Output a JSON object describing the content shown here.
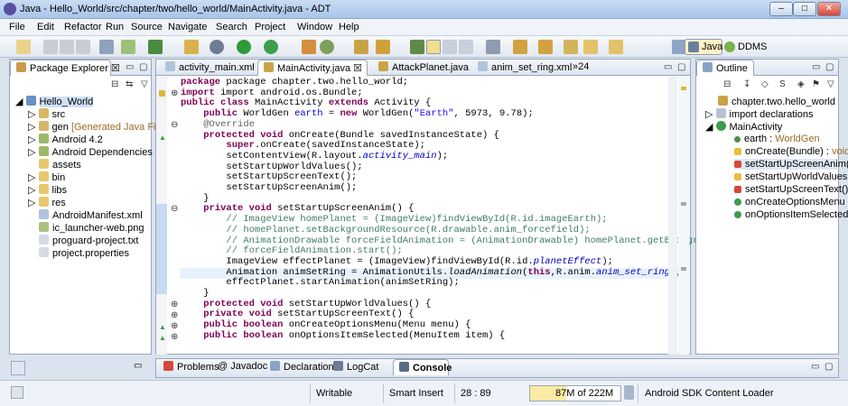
{
  "window": {
    "title": "Java - Hello_World/src/chapter/two/hello_world/MainActivity.java - ADT"
  },
  "menu": [
    "File",
    "Edit",
    "Refactor",
    "Run",
    "Source",
    "Navigate",
    "Search",
    "Project",
    "Window",
    "Help"
  ],
  "perspectives": {
    "java": "Java",
    "ddms": "DDMS"
  },
  "package_explorer": {
    "title": "Package Explorer",
    "items": [
      "Hello_World",
      "src",
      "gen",
      "[Generated Java Files]",
      "Android 4.2",
      "Android Dependencies",
      "assets",
      "bin",
      "libs",
      "res",
      "AndroidManifest.xml",
      "ic_launcher-web.png",
      "proguard-project.txt",
      "project.properties"
    ]
  },
  "editor_tabs": [
    "activity_main.xml",
    "MainActivity.java",
    "AttackPlanet.java",
    "anim_set_ring.xml",
    "»24"
  ],
  "code": {
    "l1": "package chapter.two.hello_world;",
    "l2": "import android.os.Bundle;",
    "l3": "MainActivity",
    "l3b": "Activity {",
    "l4a": "WorldGen",
    "l4b": "earth",
    "l4c": " = ",
    "l4d": " WorldGen(",
    "l4e": "\"Earth\"",
    "l4f": ", 5973, 9.78);",
    "l5": "@Override",
    "l6": "onCreate(Bundle savedInstanceState) {",
    "l7": ".onCreate(savedInstanceState);",
    "l8a": "setContentView(R.layout.",
    "l8b": "activity_main",
    "l8c": ");",
    "l9": "setStartUpWorldValues();",
    "l10": "setStartUpScreenText();",
    "l11": "setStartUpScreenAnim();",
    "l12": "}",
    "l13": "setStartUpScreenAnim() {",
    "c1": "// ImageView homePlanet = (ImageView)findViewById(R.id.imageEarth);",
    "c2": "// homePlanet.setBackgroundResource(R.drawable.anim_forcefield);",
    "c3": "// AnimationDrawable forceFieldAnimation = (AnimationDrawable) homePlanet.getBackground();",
    "c4": "// forceFieldAnimation.start();",
    "l14a": "ImageView effectPlanet = (ImageView)findViewById(R.id.",
    "l14b": "planetEffect",
    "l14c": ");",
    "l15a": "Animation animSetRing = AnimationUtils.",
    "l15b": "loadAnimation",
    "l15c": "(",
    "l15d": ",R.anim.",
    "l15e": "anim_set_ring",
    "l15f": ");",
    "l16": "effectPlanet.startAnimation(animSetRing);",
    "l17": "}",
    "l18": "setStartUpWorldValues() {",
    "l19": "setStartUpScreenText() {",
    "l20": "onCreateOptionsMenu(Menu menu) {",
    "l21": "onOptionsItemSelected(MenuItem item) {",
    "kw_package": "package",
    "kw_import": "import",
    "kw_public": "public",
    "kw_class": "class",
    "kw_extends": "extends",
    "kw_new": "new",
    "kw_protected": "protected",
    "kw_void": "void",
    "kw_super": "super",
    "kw_private": "private",
    "kw_this": "this",
    "kw_boolean": "boolean"
  },
  "outline": {
    "title": "Outline",
    "items": [
      "chapter.two.hello_world",
      "import declarations",
      "MainActivity",
      "earth",
      "WorldGen",
      "onCreate(Bundle)",
      "void",
      "setStartUpScreenAnim(",
      "setStartUpWorldValues",
      "setStartUpScreenText()",
      "onCreateOptionsMenu",
      "onOptionsItemSelected"
    ]
  },
  "bottom_tabs": [
    "Problems",
    "Javadoc",
    "Declaration",
    "LogCat",
    "Console"
  ],
  "status": {
    "writable": "Writable",
    "insert": "Smart Insert",
    "position": "28 : 89",
    "memory": "87M of 222M",
    "loader": "Android SDK Content Loader"
  },
  "colors": {
    "keyword": "#7f0055",
    "comment": "#3f7f5f",
    "string": "#2a00ff",
    "field": "#0000c0"
  }
}
